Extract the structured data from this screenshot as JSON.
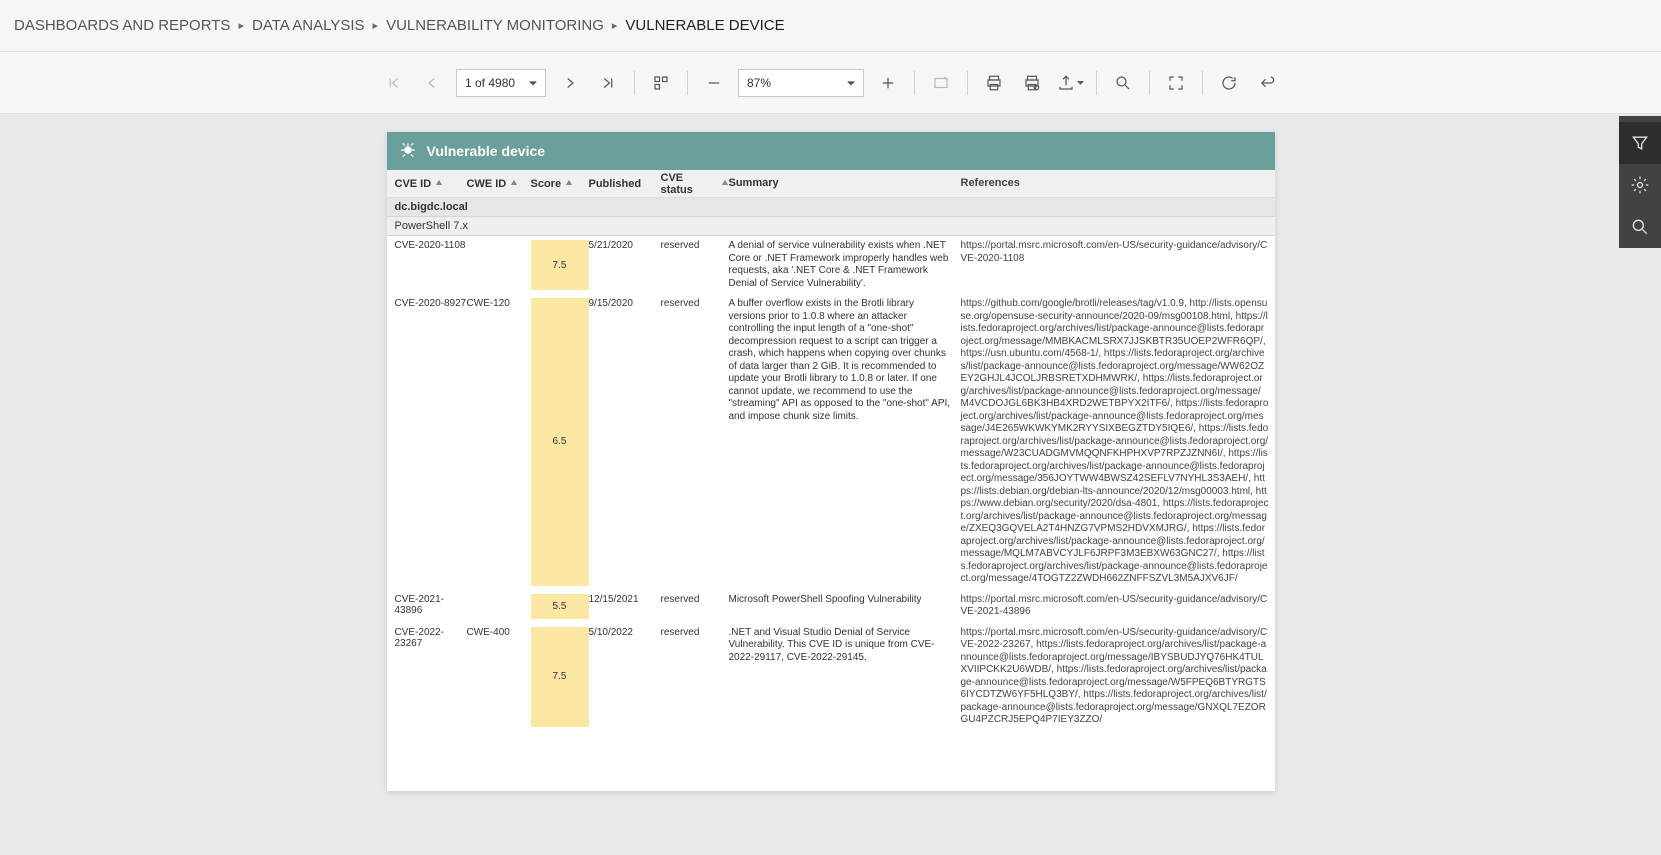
{
  "breadcrumb": {
    "items": [
      "DASHBOARDS AND REPORTS",
      "DATA ANALYSIS",
      "VULNERABILITY MONITORING"
    ],
    "current": "VULNERABLE DEVICE"
  },
  "toolbar": {
    "page_label": "1 of 4980",
    "zoom_label": "87%"
  },
  "report": {
    "title": "Vulnerable device",
    "columns": {
      "cve": "CVE ID",
      "cwe": "CWE ID",
      "score": "Score",
      "published": "Published",
      "status": "CVE status",
      "summary": "Summary",
      "references": "References"
    },
    "group": {
      "host": "dc.bigdc.local",
      "product": "PowerShell 7.x"
    },
    "rows": [
      {
        "cve": "CVE-2020-1108",
        "cwe": "",
        "score": "7.5",
        "published": "5/21/2020",
        "status": "reserved",
        "summary": "A denial of service vulnerability exists when .NET Core or .NET Framework improperly handles web requests, aka '.NET Core & .NET Framework Denial of Service Vulnerability'.",
        "references": "https://portal.msrc.microsoft.com/en-US/security-guidance/advisory/CVE-2020-1108"
      },
      {
        "cve": "CVE-2020-8927",
        "cwe": "CWE-120",
        "score": "6.5",
        "published": "9/15/2020",
        "status": "reserved",
        "summary": "A buffer overflow exists in the Brotli library versions prior to 1.0.8 where an attacker controlling the input length of a \"one-shot\" decompression request to a script can trigger a crash, which happens when copying over chunks of data larger than 2 GiB. It is recommended to update your Brotli library to 1.0.8 or later. If one cannot update, we recommend to use the \"streaming\" API as opposed to the \"one-shot\" API, and impose chunk size limits.",
        "references": "https://github.com/google/brotli/releases/tag/v1.0.9, http://lists.opensuse.org/opensuse-security-announce/2020-09/msg00108.html, https://lists.fedoraproject.org/archives/list/package-announce@lists.fedoraproject.org/message/MMBKACMLSRX7JJSKBTR35UOEP2WFR6QP/, https://usn.ubuntu.com/4568-1/, https://lists.fedoraproject.org/archives/list/package-announce@lists.fedoraproject.org/message/WW62OZEY2GHJL4JCOLJRBSRETXDHMWRK/, https://lists.fedoraproject.org/archives/list/package-announce@lists.fedoraproject.org/message/M4VCDOJGL6BK3HB4XRD2WETBPYX2ITF6/, https://lists.fedoraproject.org/archives/list/package-announce@lists.fedoraproject.org/message/J4E265WKWKYMK2RYYSIXBEGZTDY5IQE6/, https://lists.fedoraproject.org/archives/list/package-announce@lists.fedoraproject.org/message/W23CUADGMVMQQNFKHPHXVP7RPZJZNN6I/, https://lists.fedoraproject.org/archives/list/package-announce@lists.fedoraproject.org/message/356JOYTWW4BWSZ42SEFLV7NYHL3S3AEH/, https://lists.debian.org/debian-lts-announce/2020/12/msg00003.html, https://www.debian.org/security/2020/dsa-4801, https://lists.fedoraproject.org/archives/list/package-announce@lists.fedoraproject.org/message/ZXEQ3GQVELA2T4HNZG7VPMS2HDVXMJRG/, https://lists.fedoraproject.org/archives/list/package-announce@lists.fedoraproject.org/message/MQLM7ABVCYJLF6JRPF3M3EBXW63GNC27/, https://lists.fedoraproject.org/archives/list/package-announce@lists.fedoraproject.org/message/4TOGTZ2ZWDH662ZNFFSZVL3M5AJXV6JF/"
      },
      {
        "cve": "CVE-2021-43896",
        "cwe": "",
        "score": "5.5",
        "published": "12/15/2021",
        "status": "reserved",
        "summary": "Microsoft PowerShell Spoofing Vulnerability",
        "references": "https://portal.msrc.microsoft.com/en-US/security-guidance/advisory/CVE-2021-43896"
      },
      {
        "cve": "CVE-2022-23267",
        "cwe": "CWE-400",
        "score": "7.5",
        "published": "5/10/2022",
        "status": "reserved",
        "summary": ".NET and Visual Studio Denial of Service Vulnerability. This CVE ID is unique from CVE-2022-29117, CVE-2022-29145.",
        "references": "https://portal.msrc.microsoft.com/en-US/security-guidance/advisory/CVE-2022-23267, https://lists.fedoraproject.org/archives/list/package-announce@lists.fedoraproject.org/message/IBYSBUDJYQ76HK4TULXVIIPCKK2U6WDB/, https://lists.fedoraproject.org/archives/list/package-announce@lists.fedoraproject.org/message/W5FPEQ6BTYRGTS6IYCDTZW6YF5HLQ3BY/, https://lists.fedoraproject.org/archives/list/package-announce@lists.fedoraproject.org/message/GNXQL7EZORGU4PZCRJ5EPQ4P7IEY3ZZO/"
      }
    ]
  }
}
